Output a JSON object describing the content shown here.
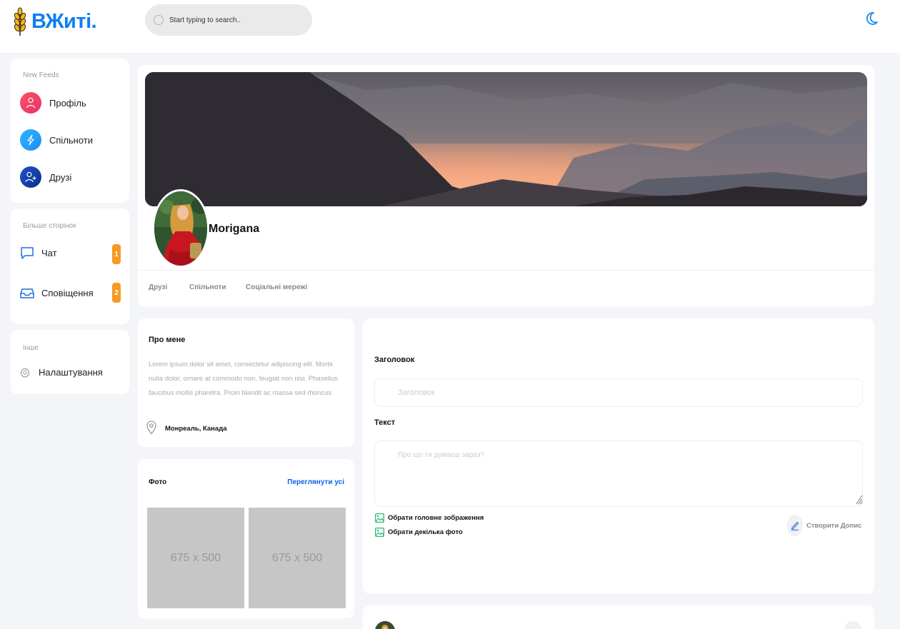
{
  "brand": {
    "name": "ВЖиті.",
    "accent": "#0d7ff2",
    "logo_icon": "wheat-icon"
  },
  "search": {
    "placeholder": "Start typing to search.."
  },
  "theme_toggle": {
    "icon": "moon-icon"
  },
  "sidebar": {
    "section1": {
      "heading": "New Feeds",
      "items": [
        {
          "label": "Профіль",
          "icon": "user-icon",
          "color": "#f0405f"
        },
        {
          "label": "Спільноти",
          "icon": "lightning-icon",
          "color": "#229cf8"
        },
        {
          "label": "Друзі",
          "icon": "add-user-icon",
          "color": "#163fa8"
        }
      ]
    },
    "section2": {
      "heading": "Більше сторінок",
      "items": [
        {
          "label": "Чат",
          "icon": "chat-icon",
          "badge": "1"
        },
        {
          "label": "Сповіщення",
          "icon": "inbox-icon",
          "badge": "2"
        }
      ]
    },
    "section3": {
      "heading": "Інше",
      "items": [
        {
          "label": "Налаштування",
          "icon": "gear-icon"
        }
      ]
    }
  },
  "profile": {
    "name": "Morigana",
    "tabs": [
      "Друзі",
      "Спільноти",
      "Соціальні мережі"
    ]
  },
  "about": {
    "title": "Про мене",
    "text": "Lorem ipsum dolor sit amet, consectetur adipiscing elit. Morbi nulla dolor, ornare at commodo non, feugiat non nisi. Phasellus faucibus mollis pharetra. Proin blandit ac massa sed rhoncus",
    "location": "Монреаль, Канада"
  },
  "photos": {
    "title": "Фото",
    "view_all": "Переглянути усі",
    "items": [
      "675 x 500",
      "675 x 500"
    ]
  },
  "post_form": {
    "title_label": "Заголовок",
    "title_placeholder": "Заголовок",
    "text_label": "Текст",
    "text_placeholder": "Про що ти думаєш зараз?",
    "main_image_option": "Обрати головне зображення",
    "multi_photo_option": "Обрати декілька фото",
    "create_button": "Створити Допис"
  }
}
